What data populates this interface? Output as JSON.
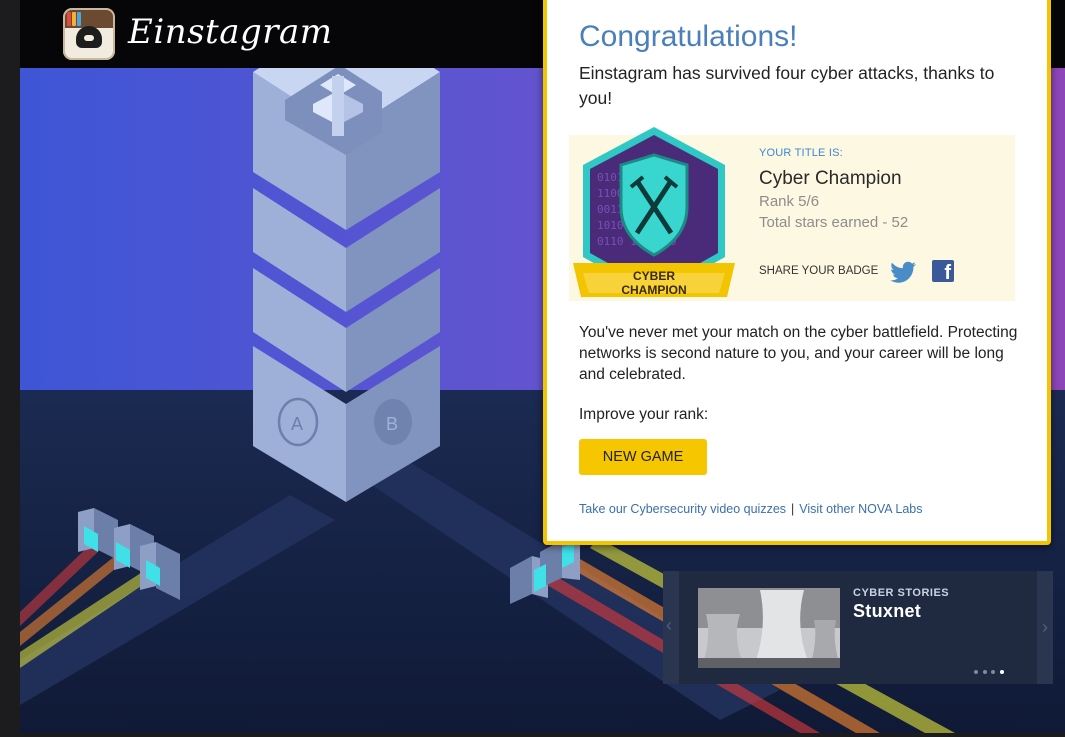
{
  "app": {
    "name": "Einstagram"
  },
  "results": {
    "heading": "Congratulations!",
    "message": "Einstagram has survived four cyber attacks, thanks to you!",
    "title_label": "YOUR TITLE IS:",
    "title_value": "Cyber Champion",
    "rank": "Rank 5/6",
    "stars": "Total stars earned - 52",
    "share_label": "SHARE YOUR BADGE",
    "badge_line1": "CYBER",
    "badge_line2": "CHAMPION",
    "description": "You've never met your match on the cyber battlefield. Protecting networks is second nature to you, and your career will be long and celebrated.",
    "improve_label": "Improve your rank:",
    "new_game_label": "NEW GAME",
    "link_quizzes": "Take our Cybersecurity video quizzes",
    "link_separator": "|",
    "link_labs": "Visit other NOVA Labs"
  },
  "server": {
    "port_a": "A",
    "port_b": "B"
  },
  "stories": {
    "kicker": "CYBER STORIES",
    "title": "Stuxnet",
    "page_count": 4,
    "active_page": 4
  },
  "icons": {
    "twitter": "twitter-icon",
    "facebook": "facebook-icon",
    "left_arrow": "chevron-left-icon",
    "right_arrow": "chevron-right-icon"
  },
  "colors": {
    "accent_yellow": "#f3c400",
    "heading_blue": "#4a7fbc",
    "link_blue": "#3b6fae",
    "badge_teal": "#2fc8c4",
    "badge_purple": "#4a2b7a"
  }
}
